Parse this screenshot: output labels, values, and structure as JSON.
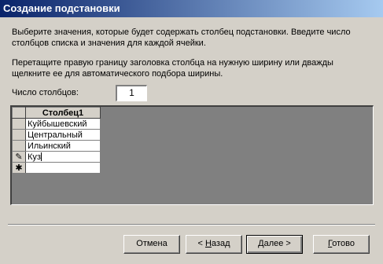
{
  "window": {
    "title": "Создание подстановки"
  },
  "intro": {
    "line1": "Выберите значения, которые будет содержать столбец подстановки. Введите число",
    "line2": "столбцов списка и значения для каждой ячейки.",
    "line3": "Перетащите правую границу заголовка столбца на нужную ширину или дважды",
    "line4": "щелкните ее для автоматического подбора ширины."
  },
  "columns": {
    "label": "Число столбцов:",
    "value": "1"
  },
  "grid": {
    "header": "Столбец1",
    "rows": [
      {
        "marker": "",
        "value": "Куйбышевский"
      },
      {
        "marker": "",
        "value": "Центральный"
      },
      {
        "marker": "",
        "value": "Ильинский"
      },
      {
        "marker": "✎",
        "value": "Куз"
      },
      {
        "marker": "✱",
        "value": ""
      }
    ]
  },
  "buttons": {
    "cancel": "Отмена",
    "back_prefix": "< ",
    "back_hot": "Н",
    "back_rest": "азад",
    "next_hot": "Д",
    "next_rest": "алее >",
    "finish_hot": "Г",
    "finish_rest": "отово"
  }
}
